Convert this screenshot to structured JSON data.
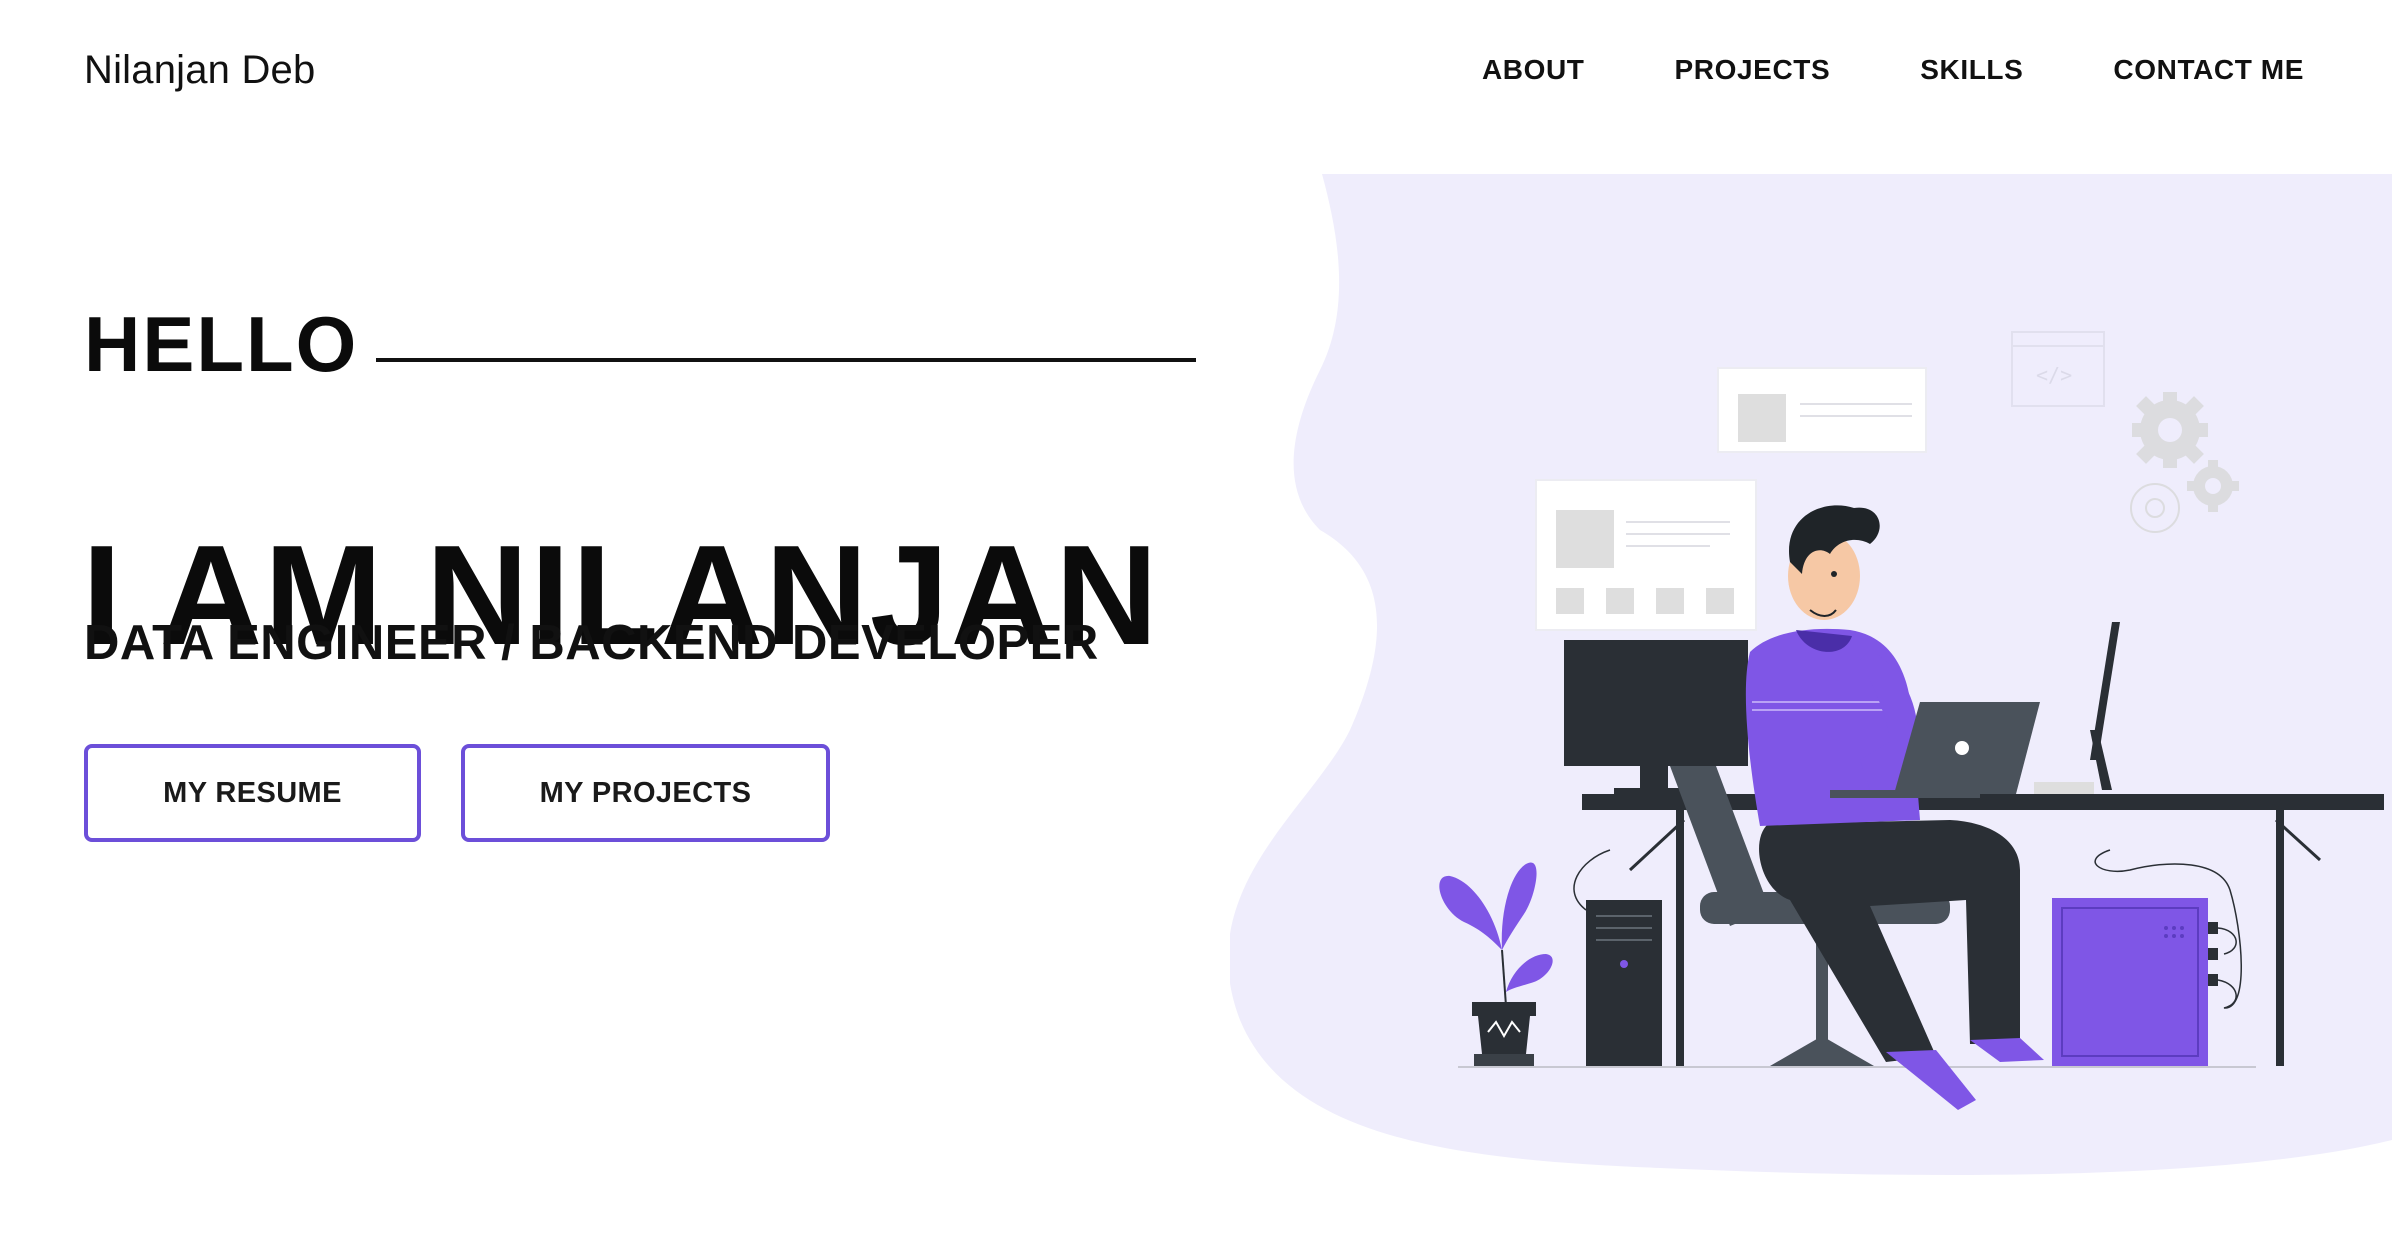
{
  "header": {
    "brand": "Nilanjan Deb",
    "nav": [
      {
        "label": "ABOUT"
      },
      {
        "label": "PROJECTS"
      },
      {
        "label": "SKILLS"
      },
      {
        "label": "CONTACT ME"
      }
    ]
  },
  "hero": {
    "greeting": "HELLO",
    "title": "I AM NILANJAN",
    "subtitle": "DATA ENGINEER / BACKEND DEVELOPER",
    "buttons": {
      "resume": "MY RESUME",
      "projects": "MY PROJECTS"
    }
  },
  "theme": {
    "accent": "#6c4fd9",
    "blob": "#efedfc",
    "purple": "#7f56e6",
    "dark": "#2a2f35"
  },
  "illustration": {
    "subject": "developer-working-at-desk",
    "icons": [
      "code-window-icon",
      "gear-icon"
    ]
  }
}
